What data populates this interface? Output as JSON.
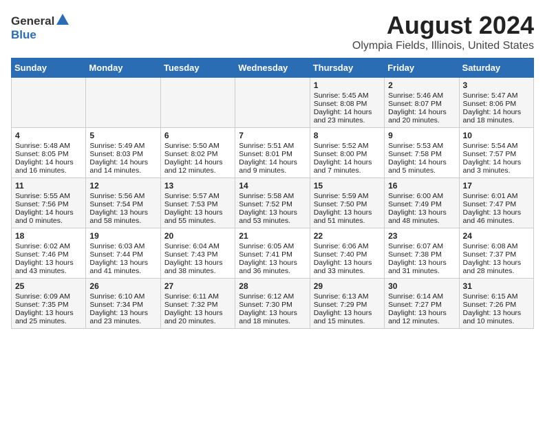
{
  "logo": {
    "general": "General",
    "blue": "Blue"
  },
  "header": {
    "title": "August 2024",
    "subtitle": "Olympia Fields, Illinois, United States"
  },
  "days_of_week": [
    "Sunday",
    "Monday",
    "Tuesday",
    "Wednesday",
    "Thursday",
    "Friday",
    "Saturday"
  ],
  "weeks": [
    [
      {
        "day": "",
        "info": ""
      },
      {
        "day": "",
        "info": ""
      },
      {
        "day": "",
        "info": ""
      },
      {
        "day": "",
        "info": ""
      },
      {
        "day": "1",
        "info": "Sunrise: 5:45 AM\nSunset: 8:08 PM\nDaylight: 14 hours\nand 23 minutes."
      },
      {
        "day": "2",
        "info": "Sunrise: 5:46 AM\nSunset: 8:07 PM\nDaylight: 14 hours\nand 20 minutes."
      },
      {
        "day": "3",
        "info": "Sunrise: 5:47 AM\nSunset: 8:06 PM\nDaylight: 14 hours\nand 18 minutes."
      }
    ],
    [
      {
        "day": "4",
        "info": "Sunrise: 5:48 AM\nSunset: 8:05 PM\nDaylight: 14 hours\nand 16 minutes."
      },
      {
        "day": "5",
        "info": "Sunrise: 5:49 AM\nSunset: 8:03 PM\nDaylight: 14 hours\nand 14 minutes."
      },
      {
        "day": "6",
        "info": "Sunrise: 5:50 AM\nSunset: 8:02 PM\nDaylight: 14 hours\nand 12 minutes."
      },
      {
        "day": "7",
        "info": "Sunrise: 5:51 AM\nSunset: 8:01 PM\nDaylight: 14 hours\nand 9 minutes."
      },
      {
        "day": "8",
        "info": "Sunrise: 5:52 AM\nSunset: 8:00 PM\nDaylight: 14 hours\nand 7 minutes."
      },
      {
        "day": "9",
        "info": "Sunrise: 5:53 AM\nSunset: 7:58 PM\nDaylight: 14 hours\nand 5 minutes."
      },
      {
        "day": "10",
        "info": "Sunrise: 5:54 AM\nSunset: 7:57 PM\nDaylight: 14 hours\nand 3 minutes."
      }
    ],
    [
      {
        "day": "11",
        "info": "Sunrise: 5:55 AM\nSunset: 7:56 PM\nDaylight: 14 hours\nand 0 minutes."
      },
      {
        "day": "12",
        "info": "Sunrise: 5:56 AM\nSunset: 7:54 PM\nDaylight: 13 hours\nand 58 minutes."
      },
      {
        "day": "13",
        "info": "Sunrise: 5:57 AM\nSunset: 7:53 PM\nDaylight: 13 hours\nand 55 minutes."
      },
      {
        "day": "14",
        "info": "Sunrise: 5:58 AM\nSunset: 7:52 PM\nDaylight: 13 hours\nand 53 minutes."
      },
      {
        "day": "15",
        "info": "Sunrise: 5:59 AM\nSunset: 7:50 PM\nDaylight: 13 hours\nand 51 minutes."
      },
      {
        "day": "16",
        "info": "Sunrise: 6:00 AM\nSunset: 7:49 PM\nDaylight: 13 hours\nand 48 minutes."
      },
      {
        "day": "17",
        "info": "Sunrise: 6:01 AM\nSunset: 7:47 PM\nDaylight: 13 hours\nand 46 minutes."
      }
    ],
    [
      {
        "day": "18",
        "info": "Sunrise: 6:02 AM\nSunset: 7:46 PM\nDaylight: 13 hours\nand 43 minutes."
      },
      {
        "day": "19",
        "info": "Sunrise: 6:03 AM\nSunset: 7:44 PM\nDaylight: 13 hours\nand 41 minutes."
      },
      {
        "day": "20",
        "info": "Sunrise: 6:04 AM\nSunset: 7:43 PM\nDaylight: 13 hours\nand 38 minutes."
      },
      {
        "day": "21",
        "info": "Sunrise: 6:05 AM\nSunset: 7:41 PM\nDaylight: 13 hours\nand 36 minutes."
      },
      {
        "day": "22",
        "info": "Sunrise: 6:06 AM\nSunset: 7:40 PM\nDaylight: 13 hours\nand 33 minutes."
      },
      {
        "day": "23",
        "info": "Sunrise: 6:07 AM\nSunset: 7:38 PM\nDaylight: 13 hours\nand 31 minutes."
      },
      {
        "day": "24",
        "info": "Sunrise: 6:08 AM\nSunset: 7:37 PM\nDaylight: 13 hours\nand 28 minutes."
      }
    ],
    [
      {
        "day": "25",
        "info": "Sunrise: 6:09 AM\nSunset: 7:35 PM\nDaylight: 13 hours\nand 25 minutes."
      },
      {
        "day": "26",
        "info": "Sunrise: 6:10 AM\nSunset: 7:34 PM\nDaylight: 13 hours\nand 23 minutes."
      },
      {
        "day": "27",
        "info": "Sunrise: 6:11 AM\nSunset: 7:32 PM\nDaylight: 13 hours\nand 20 minutes."
      },
      {
        "day": "28",
        "info": "Sunrise: 6:12 AM\nSunset: 7:30 PM\nDaylight: 13 hours\nand 18 minutes."
      },
      {
        "day": "29",
        "info": "Sunrise: 6:13 AM\nSunset: 7:29 PM\nDaylight: 13 hours\nand 15 minutes."
      },
      {
        "day": "30",
        "info": "Sunrise: 6:14 AM\nSunset: 7:27 PM\nDaylight: 13 hours\nand 12 minutes."
      },
      {
        "day": "31",
        "info": "Sunrise: 6:15 AM\nSunset: 7:26 PM\nDaylight: 13 hours\nand 10 minutes."
      }
    ]
  ]
}
